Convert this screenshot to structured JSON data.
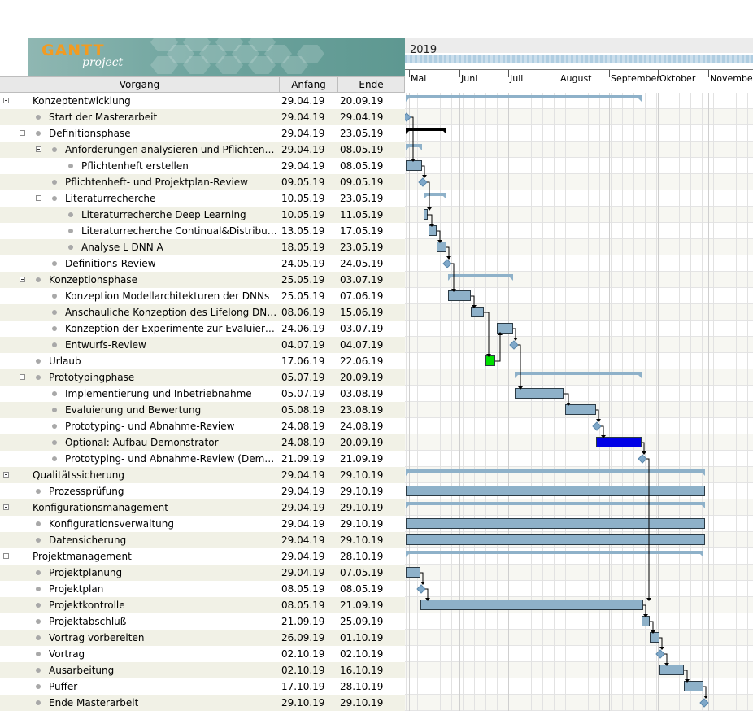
{
  "logo": {
    "brand": "GANTT",
    "sub": "project"
  },
  "table": {
    "col_task": "Vorgang",
    "col_start": "Anfang",
    "col_end": "Ende"
  },
  "chart_header": {
    "year": "2019",
    "months": [
      "Mai",
      "Juni",
      "Juli",
      "August",
      "September",
      "Oktober",
      "November"
    ]
  },
  "tasks": [
    {
      "name": "Konzeptentwicklung",
      "start": "29.04.19",
      "end": "20.09.19",
      "level": 0,
      "group": true
    },
    {
      "name": "Start der Masterarbeit",
      "start": "29.04.19",
      "end": "29.04.19",
      "level": 1,
      "milestone": true
    },
    {
      "name": "Definitionsphase",
      "start": "29.04.19",
      "end": "23.05.19",
      "level": 1,
      "group": true,
      "color": "#000000"
    },
    {
      "name": "Anforderungen analysieren und Pflichtenheft er...",
      "start": "29.04.19",
      "end": "08.05.19",
      "level": 2,
      "group": true
    },
    {
      "name": "Pflichtenheft erstellen",
      "start": "29.04.19",
      "end": "08.05.19",
      "level": 3
    },
    {
      "name": "Pflichtenheft- und Projektplan-Review",
      "start": "09.05.19",
      "end": "09.05.19",
      "level": 2,
      "milestone": true
    },
    {
      "name": "Literaturrecherche",
      "start": "10.05.19",
      "end": "23.05.19",
      "level": 2,
      "group": true
    },
    {
      "name": "Literaturrecherche Deep Learning",
      "start": "10.05.19",
      "end": "11.05.19",
      "level": 3
    },
    {
      "name": "Literaturrecherche Continual&Distributed L...",
      "start": "13.05.19",
      "end": "17.05.19",
      "level": 3
    },
    {
      "name": "Analyse L DNN A",
      "start": "18.05.19",
      "end": "23.05.19",
      "level": 3
    },
    {
      "name": "Definitions-Review",
      "start": "24.05.19",
      "end": "24.05.19",
      "level": 2,
      "milestone": true
    },
    {
      "name": "Konzeptionsphase",
      "start": "25.05.19",
      "end": "03.07.19",
      "level": 1,
      "group": true
    },
    {
      "name": "Konzeption Modellarchitekturen der DNNs",
      "start": "25.05.19",
      "end": "07.06.19",
      "level": 2
    },
    {
      "name": "Anschauliche Konzeption des Lifelong DNN Alg...",
      "start": "08.06.19",
      "end": "15.06.19",
      "level": 2
    },
    {
      "name": "Konzeption der Experimente zur Evaluierung",
      "start": "24.06.19",
      "end": "03.07.19",
      "level": 2
    },
    {
      "name": "Entwurfs-Review",
      "start": "04.07.19",
      "end": "04.07.19",
      "level": 2,
      "milestone": true
    },
    {
      "name": "Urlaub",
      "start": "17.06.19",
      "end": "22.06.19",
      "level": 1,
      "color": "#00e000"
    },
    {
      "name": "Prototypingphase",
      "start": "05.07.19",
      "end": "20.09.19",
      "level": 1,
      "group": true
    },
    {
      "name": "Implementierung und Inbetriebnahme",
      "start": "05.07.19",
      "end": "03.08.19",
      "level": 2
    },
    {
      "name": "Evaluierung und Bewertung",
      "start": "05.08.19",
      "end": "23.08.19",
      "level": 2
    },
    {
      "name": "Prototyping- und Abnahme-Review",
      "start": "24.08.19",
      "end": "24.08.19",
      "level": 2,
      "milestone": true
    },
    {
      "name": "Optional: Aufbau Demonstrator",
      "start": "24.08.19",
      "end": "20.09.19",
      "level": 2,
      "color": "#0000e6"
    },
    {
      "name": "Prototyping- und Abnahme-Review (Demonstr...",
      "start": "21.09.19",
      "end": "21.09.19",
      "level": 2,
      "milestone": true
    },
    {
      "name": "Qualitätssicherung",
      "start": "29.04.19",
      "end": "29.10.19",
      "level": 0,
      "group": true
    },
    {
      "name": "Prozessprüfung",
      "start": "29.04.19",
      "end": "29.10.19",
      "level": 1
    },
    {
      "name": "Konfigurationsmanagement",
      "start": "29.04.19",
      "end": "29.10.19",
      "level": 0,
      "group": true
    },
    {
      "name": "Konfigurationsverwaltung",
      "start": "29.04.19",
      "end": "29.10.19",
      "level": 1
    },
    {
      "name": "Datensicherung",
      "start": "29.04.19",
      "end": "29.10.19",
      "level": 1
    },
    {
      "name": "Projektmanagement",
      "start": "29.04.19",
      "end": "28.10.19",
      "level": 0,
      "group": true
    },
    {
      "name": "Projektplanung",
      "start": "29.04.19",
      "end": "07.05.19",
      "level": 1
    },
    {
      "name": "Projektplan",
      "start": "08.05.19",
      "end": "08.05.19",
      "level": 1,
      "milestone": true
    },
    {
      "name": "Projektkontrolle",
      "start": "08.05.19",
      "end": "21.09.19",
      "level": 1
    },
    {
      "name": "Projektabschluß",
      "start": "21.09.19",
      "end": "25.09.19",
      "level": 1
    },
    {
      "name": "Vortrag vorbereiten",
      "start": "26.09.19",
      "end": "01.10.19",
      "level": 1
    },
    {
      "name": "Vortrag",
      "start": "02.10.19",
      "end": "02.10.19",
      "level": 1,
      "milestone": true
    },
    {
      "name": "Ausarbeitung",
      "start": "02.10.19",
      "end": "16.10.19",
      "level": 1
    },
    {
      "name": "Puffer",
      "start": "17.10.19",
      "end": "28.10.19",
      "level": 1
    },
    {
      "name": "Ende Masterarbeit",
      "start": "29.10.19",
      "end": "29.10.19",
      "level": 1,
      "milestone": true
    }
  ],
  "colors": {
    "bar": "#8eb1c9",
    "bar_border": "#2b3a44",
    "alt_row": "#f1f1e6",
    "header_bg": "#e8e8e8"
  }
}
